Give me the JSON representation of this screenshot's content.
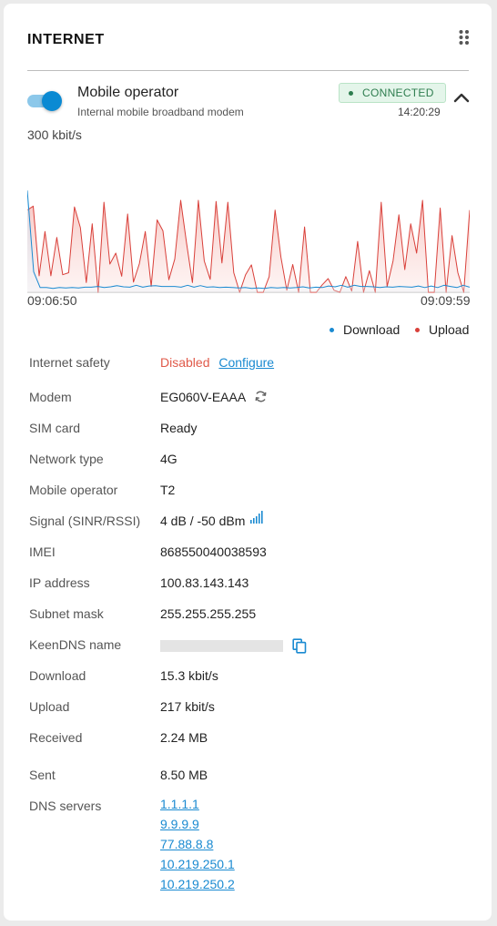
{
  "widget": {
    "title": "INTERNET",
    "menu_icon": "drag-dots-icon"
  },
  "connection": {
    "name": "Mobile operator",
    "description": "Internal mobile broadband modem",
    "enabled": true,
    "status": "CONNECTED",
    "time": "14:20:29",
    "accent_color": "#0a8ad3",
    "status_color": "#2e7d4f"
  },
  "chart": {
    "scale_label": "300 kbit/s",
    "time_start": "09:06:50",
    "time_end": "09:09:59",
    "legend": {
      "download": "Download",
      "upload": "Upload"
    }
  },
  "chart_data": {
    "type": "line",
    "ylim": [
      0,
      300
    ],
    "x_range": [
      "09:06:50",
      "09:09:59"
    ],
    "series": [
      {
        "name": "Download",
        "color": "#1a8ad1",
        "values": [
          260,
          52,
          12,
          12,
          10,
          12,
          11,
          12,
          11,
          13,
          13,
          15,
          12,
          14,
          17,
          14,
          13,
          18,
          13,
          16,
          17,
          15,
          15,
          15,
          13,
          18,
          13,
          17,
          13,
          14,
          12,
          13,
          12,
          11,
          12,
          10,
          11,
          10,
          12,
          11,
          12,
          11,
          12,
          14,
          11,
          13,
          12,
          16,
          14,
          18,
          13,
          18,
          15,
          15,
          14,
          12,
          14,
          13,
          15,
          14,
          13,
          16,
          12,
          16,
          12,
          18,
          15,
          12,
          18,
          13
        ]
      },
      {
        "name": "Upload",
        "color": "#d9403a",
        "values": [
          210,
          220,
          42,
          155,
          42,
          140,
          45,
          50,
          218,
          165,
          25,
          175,
          0,
          230,
          72,
          100,
          41,
          200,
          26,
          73,
          155,
          15,
          185,
          157,
          32,
          85,
          235,
          125,
          25,
          235,
          80,
          33,
          232,
          75,
          230,
          50,
          0,
          45,
          70,
          0,
          0,
          40,
          210,
          90,
          5,
          71,
          0,
          167,
          0,
          0,
          19,
          35,
          5,
          0,
          40,
          3,
          130,
          0,
          55,
          0,
          230,
          15,
          80,
          198,
          58,
          175,
          100,
          235,
          0,
          0,
          215,
          0,
          145,
          50,
          0,
          210
        ]
      }
    ]
  },
  "details": {
    "internet_safety": {
      "label": "Internet safety",
      "value": "Disabled",
      "link": "Configure"
    },
    "modem": {
      "label": "Modem",
      "value": "EG060V-EAAA"
    },
    "sim_card": {
      "label": "SIM card",
      "value": "Ready"
    },
    "network_type": {
      "label": "Network type",
      "value": "4G"
    },
    "mobile_operator": {
      "label": "Mobile operator",
      "value": "T2"
    },
    "signal": {
      "label": "Signal (SINR/RSSI)",
      "value": "4 dB / -50 dBm"
    },
    "imei": {
      "label": "IMEI",
      "value": "868550040038593"
    },
    "ip_address": {
      "label": "IP address",
      "value": "100.83.143.143"
    },
    "subnet_mask": {
      "label": "Subnet mask",
      "value": "255.255.255.255"
    },
    "keendns": {
      "label": "KeenDNS name",
      "value": ""
    },
    "download": {
      "label": "Download",
      "value": "15.3 kbit/s"
    },
    "upload": {
      "label": "Upload",
      "value": "217 kbit/s"
    },
    "received": {
      "label": "Received",
      "value": "2.24 MB"
    },
    "sent": {
      "label": "Sent",
      "value": "8.50 MB"
    },
    "dns_servers": {
      "label": "DNS servers",
      "values": [
        "1.1.1.1",
        "9.9.9.9",
        "77.88.8.8",
        "10.219.250.1",
        "10.219.250.2"
      ]
    }
  }
}
